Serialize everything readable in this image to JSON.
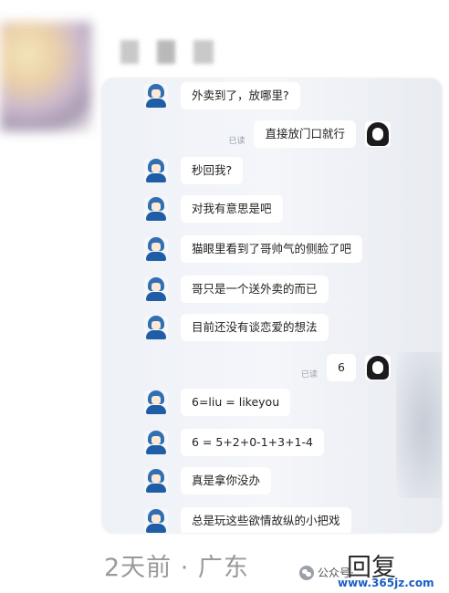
{
  "messages": [
    {
      "side": "left",
      "text": "外卖到了，放哪里?"
    },
    {
      "side": "right",
      "text": "直接放门口就行",
      "read": "已读"
    },
    {
      "side": "left",
      "text": "秒回我?"
    },
    {
      "side": "left",
      "text": "对我有意思是吧"
    },
    {
      "side": "left",
      "text": "猫眼里看到了哥帅气的侧脸了吧"
    },
    {
      "side": "left",
      "text": "哥只是一个送外卖的而已"
    },
    {
      "side": "left",
      "text": "目前还没有谈恋爱的想法"
    },
    {
      "side": "right",
      "text": "6",
      "read": "已读"
    },
    {
      "side": "left",
      "text": "6=liu = likeyou"
    },
    {
      "side": "left",
      "text": "6 = 5+2+0-1+3+1-4"
    },
    {
      "side": "left",
      "text": "真是拿你没办"
    },
    {
      "side": "left",
      "text": "总是玩这些欲情故纵的小把戏"
    }
  ],
  "footer": {
    "time_location": "2天前 · 广东",
    "reply": "回复",
    "watermark_text": "公众号·",
    "watermark_url": "www.365jz.com"
  },
  "icons": {
    "sender_avatar": "blue-hair-avatar-icon",
    "me_avatar": "black-hair-avatar-icon",
    "watermark": "wechat-icon"
  }
}
